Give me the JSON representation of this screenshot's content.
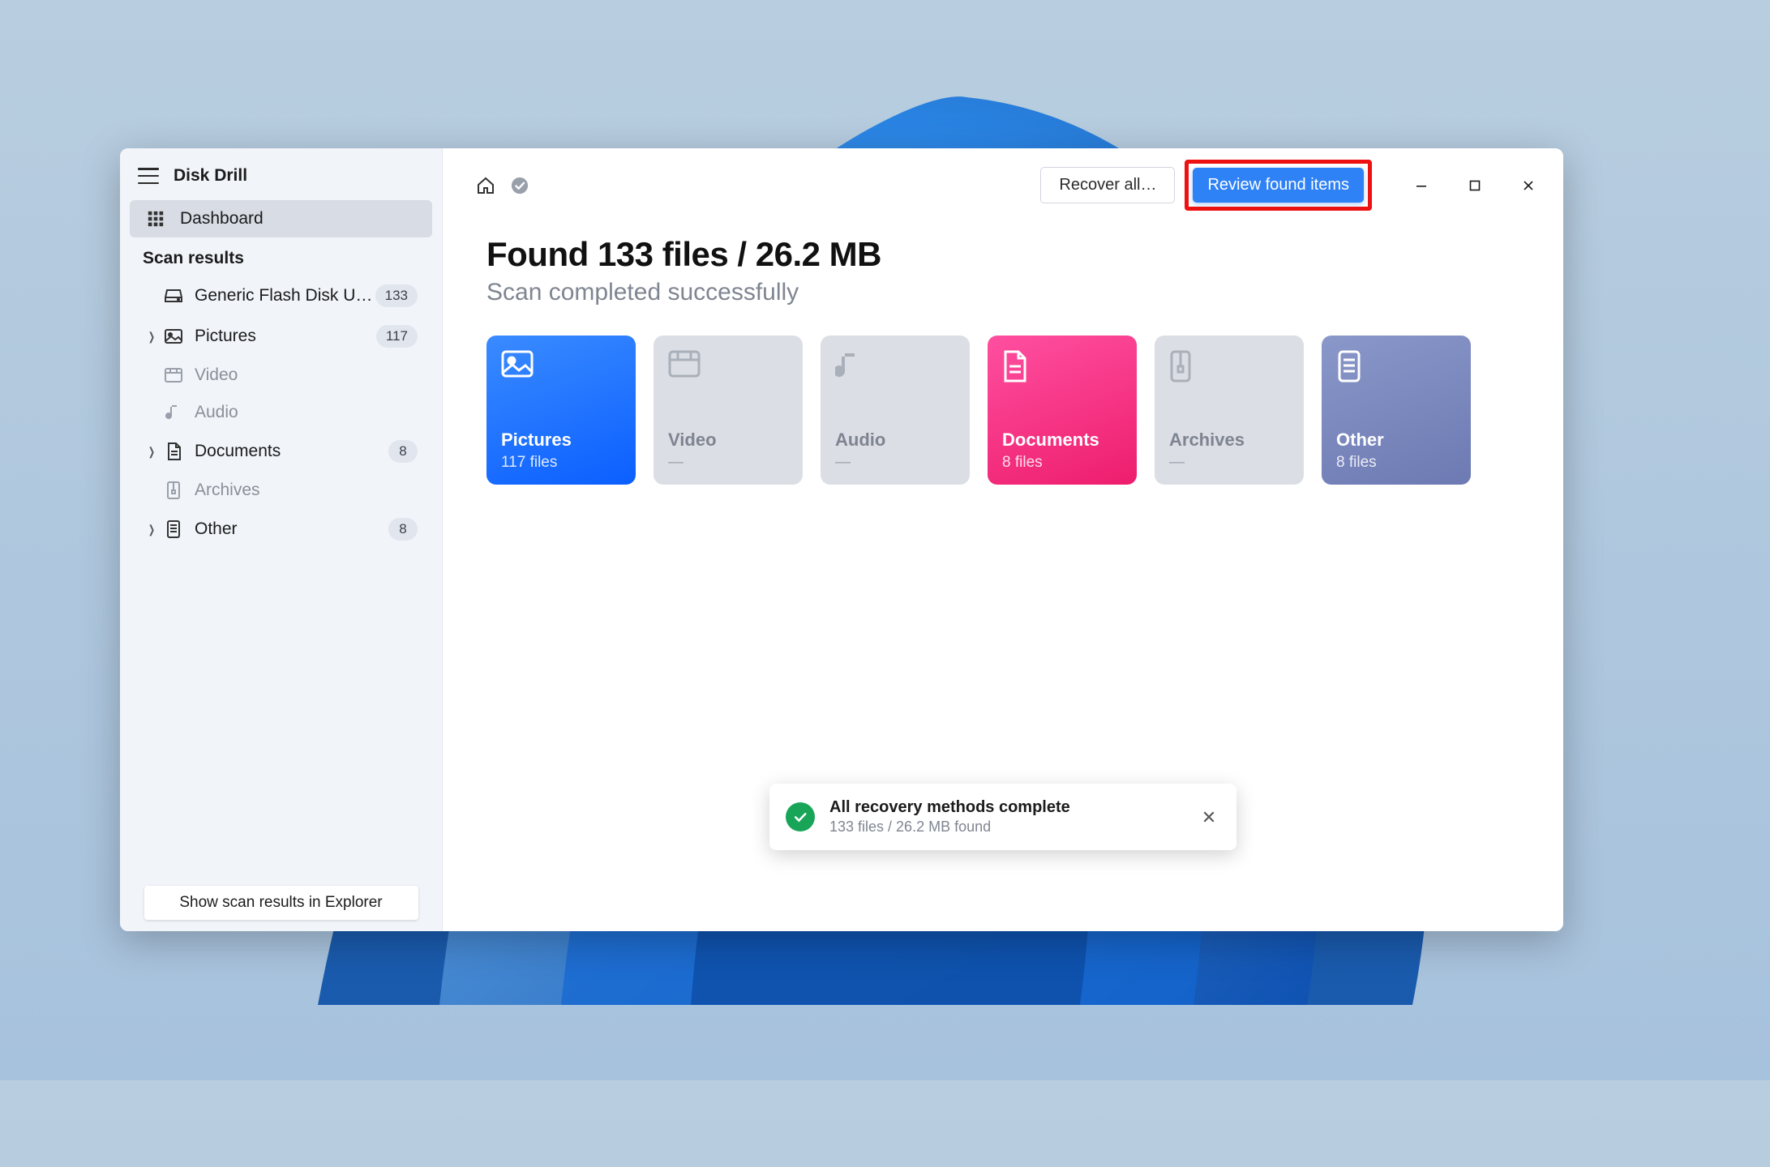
{
  "app_title": "Disk Drill",
  "sidebar": {
    "dashboard_label": "Dashboard",
    "section_label": "Scan results",
    "footer_button": "Show scan results in Explorer",
    "items": [
      {
        "label": "Generic Flash Disk USB…",
        "count": "133",
        "icon": "drive",
        "indent": true,
        "muted": false,
        "chevron": false
      },
      {
        "label": "Pictures",
        "count": "117",
        "icon": "picture",
        "indent": false,
        "muted": false,
        "chevron": true
      },
      {
        "label": "Video",
        "count": "",
        "icon": "video",
        "indent": true,
        "muted": true,
        "chevron": false
      },
      {
        "label": "Audio",
        "count": "",
        "icon": "audio",
        "indent": true,
        "muted": true,
        "chevron": false
      },
      {
        "label": "Documents",
        "count": "8",
        "icon": "document",
        "indent": false,
        "muted": false,
        "chevron": true
      },
      {
        "label": "Archives",
        "count": "",
        "icon": "archive",
        "indent": true,
        "muted": true,
        "chevron": false
      },
      {
        "label": "Other",
        "count": "8",
        "icon": "other",
        "indent": false,
        "muted": false,
        "chevron": true
      }
    ]
  },
  "toolbar": {
    "recover_label": "Recover all…",
    "review_label": "Review found items"
  },
  "summary": {
    "headline": "Found 133 files / 26.2 MB",
    "subhead": "Scan completed successfully"
  },
  "cards": [
    {
      "key": "pictures",
      "title": "Pictures",
      "sub": "117 files",
      "variant": "pictures",
      "active": true
    },
    {
      "key": "video",
      "title": "Video",
      "sub": "—",
      "variant": "gray",
      "active": false
    },
    {
      "key": "audio",
      "title": "Audio",
      "sub": "—",
      "variant": "gray",
      "active": false
    },
    {
      "key": "documents",
      "title": "Documents",
      "sub": "8 files",
      "variant": "documents",
      "active": true
    },
    {
      "key": "archives",
      "title": "Archives",
      "sub": "—",
      "variant": "gray",
      "active": false
    },
    {
      "key": "other",
      "title": "Other",
      "sub": "8 files",
      "variant": "other",
      "active": true
    }
  ],
  "toast": {
    "title": "All recovery methods complete",
    "sub": "133 files / 26.2 MB found"
  },
  "colors": {
    "accent_blue": "#2f82f6",
    "highlight_red": "#ee1111"
  }
}
